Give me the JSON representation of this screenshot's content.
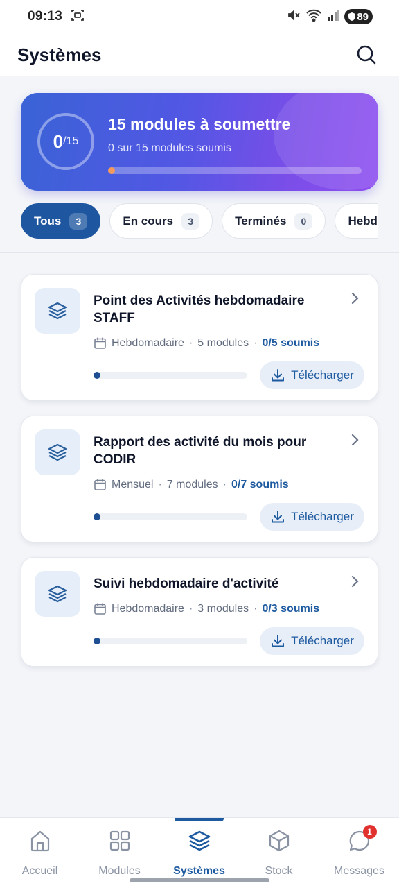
{
  "status_bar": {
    "time": "09:13",
    "battery": "89"
  },
  "header": {
    "title": "Systèmes",
    "search_icon": "search-icon"
  },
  "summary": {
    "done": "0",
    "total": "/15",
    "title": "15 modules à soumettre",
    "subtitle": "0 sur 15 modules soumis",
    "progress": 0
  },
  "filters": [
    {
      "label": "Tous",
      "count": "3",
      "active": true
    },
    {
      "label": "En cours",
      "count": "3",
      "active": false
    },
    {
      "label": "Terminés",
      "count": "0",
      "active": false
    },
    {
      "label": "Hebdo",
      "count": "",
      "active": false
    }
  ],
  "cards": [
    {
      "title": "Point des Activités hebdomadaire STAFF",
      "frequency": "Hebdomadaire",
      "modules": "5 modules",
      "submitted": "0/5 soumis",
      "progress": 0,
      "download_label": "Télécharger"
    },
    {
      "title": "Rapport des activité du mois pour CODIR",
      "frequency": "Mensuel",
      "modules": "7 modules",
      "submitted": "0/7 soumis",
      "progress": 0,
      "download_label": "Télécharger"
    },
    {
      "title": "Suivi hebdomadaire d'activité",
      "frequency": "Hebdomadaire",
      "modules": "3 modules",
      "submitted": "0/3 soumis",
      "progress": 0,
      "download_label": "Télécharger"
    }
  ],
  "meta_separator": "·",
  "bottom_nav": [
    {
      "label": "Accueil",
      "icon": "home-icon",
      "active": false
    },
    {
      "label": "Modules",
      "icon": "grid-icon",
      "active": false
    },
    {
      "label": "Systèmes",
      "icon": "layers-icon",
      "active": true
    },
    {
      "label": "Stock",
      "icon": "box-icon",
      "active": false
    },
    {
      "label": "Messages",
      "icon": "chat-icon",
      "active": false,
      "badge": "1"
    }
  ],
  "colors": {
    "accent": "#1e5aa0",
    "hero_start": "#3a63d6",
    "hero_end": "#8f4ef0",
    "badge": "#e0312f"
  }
}
